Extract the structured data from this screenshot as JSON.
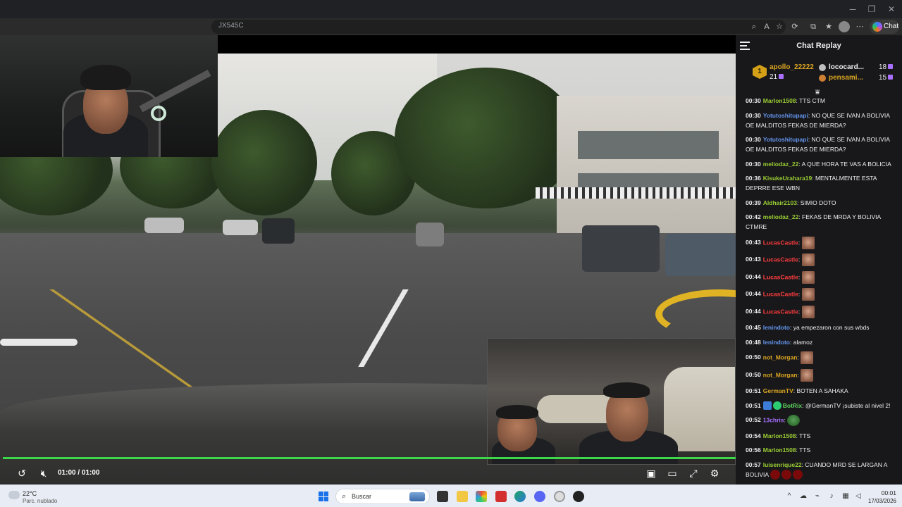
{
  "browser": {
    "address_text": "JX545C",
    "chat_button_label": "Chat",
    "toolbar_icons": [
      "zoom-icon",
      "read-aloud-icon",
      "favorite-icon",
      "extensions-icon",
      "split-screen-icon",
      "favorites-bar-icon",
      "profile-icon",
      "more-icon"
    ]
  },
  "player": {
    "time_display": "01:00 / 01:00",
    "progress_fraction": 1.0,
    "progress_color": "#3cd84a",
    "controls": [
      "replay-icon",
      "mute-icon",
      "pip-icon",
      "theater-icon",
      "fullscreen-icon",
      "settings-icon"
    ]
  },
  "chat": {
    "title": "Chat Replay",
    "top_gifter": {
      "rank": "1",
      "name": "apollo_22222",
      "count": "21",
      "second_name": "lococard...",
      "second_count": "18",
      "third_name": "pensami...",
      "third_count": "15"
    },
    "messages": [
      {
        "ts": "00:30",
        "user": "Marlon1508",
        "color": "#9acd32",
        "text": "TTS CTM",
        "emotes": 0
      },
      {
        "ts": "00:30",
        "user": "Yotutoshitupapi",
        "color": "#6495ed",
        "text": "NO QUE SE IVAN A BOLIVIA OE MALDITOS FEKAS DE MIERDA?",
        "emotes": 0
      },
      {
        "ts": "00:30",
        "user": "Yotutoshitupapi",
        "color": "#6495ed",
        "text": "NO QUE SE IVAN A BOLIVIA OE MALDITOS FEKAS DE MIERDA?",
        "emotes": 0
      },
      {
        "ts": "00:30",
        "user": "meliodaz_22",
        "color": "#9acd32",
        "text": "A QUE HORA TE VAS A BOLICIA",
        "emotes": 0
      },
      {
        "ts": "00:36",
        "user": "KisukeUrahara19",
        "color": "#9acd32",
        "text": "MENTALMENTE ESTA DEPRRE ESE WBN",
        "emotes": 0
      },
      {
        "ts": "00:39",
        "user": "Aldhair2103",
        "color": "#9acd32",
        "text": "SIMIO DOTO",
        "emotes": 0
      },
      {
        "ts": "00:42",
        "user": "meliodaz_22",
        "color": "#9acd32",
        "text": "FEKAS DE MRDA Y BOLIVIA CTMRE",
        "emotes": 0
      },
      {
        "ts": "00:43",
        "user": "LucasCastle",
        "color": "#ff3c3c",
        "text": "",
        "emotes": 1
      },
      {
        "ts": "00:43",
        "user": "LucasCastle",
        "color": "#ff3c3c",
        "text": "",
        "emotes": 1
      },
      {
        "ts": "00:44",
        "user": "LucasCastle",
        "color": "#ff3c3c",
        "text": "",
        "emotes": 1
      },
      {
        "ts": "00:44",
        "user": "LucasCastle",
        "color": "#ff3c3c",
        "text": "",
        "emotes": 1
      },
      {
        "ts": "00:44",
        "user": "LucasCastle",
        "color": "#ff3c3c",
        "text": "",
        "emotes": 1
      },
      {
        "ts": "00:45",
        "user": "lenindoto",
        "color": "#6495ed",
        "text": "ya empezaron con sus wbds",
        "emotes": 0
      },
      {
        "ts": "00:48",
        "user": "lenindoto",
        "color": "#6495ed",
        "text": "alamoz",
        "emotes": 0
      },
      {
        "ts": "00:50",
        "user": "not_Morgan",
        "color": "#daa520",
        "text": "",
        "emotes": 1
      },
      {
        "ts": "00:50",
        "user": "not_Morgan",
        "color": "#daa520",
        "text": "",
        "emotes": 1
      },
      {
        "ts": "00:51",
        "user": "GermanTV",
        "color": "#daa520",
        "text": "BOTEN A SAHAKA",
        "emotes": 0
      },
      {
        "ts": "00:51",
        "user": "BotRix",
        "color": "#5dd35d",
        "text": "@GermanTV ¡subiste al nivel 2!",
        "emotes": 0,
        "badges": true
      },
      {
        "ts": "00:52",
        "user": "13chris",
        "color": "#a970ff",
        "text": "",
        "emotes": 0,
        "pepe": true
      },
      {
        "ts": "00:54",
        "user": "Marlon1508",
        "color": "#9acd32",
        "text": "TTS",
        "emotes": 0
      },
      {
        "ts": "00:56",
        "user": "Marlon1508",
        "color": "#9acd32",
        "text": "TTS",
        "emotes": 0
      },
      {
        "ts": "00:57",
        "user": "luisenrique22",
        "color": "#9acd32",
        "text": "CUANDO MRD SE LARGAN A BOLIVIA",
        "emotes": 0,
        "trailing": 3
      }
    ]
  },
  "taskbar": {
    "temperature": "22°C",
    "weather": "Parc. nublado",
    "search_label": "Buscar",
    "time": "00:01",
    "date": "17/03/2026"
  }
}
